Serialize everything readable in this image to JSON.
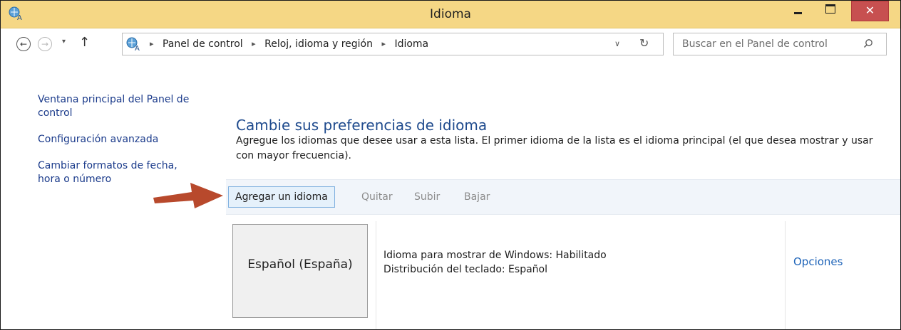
{
  "window": {
    "title": "Idioma",
    "close_glyph": "✕"
  },
  "nav": {
    "back_glyph": "←",
    "forward_glyph": "→",
    "recent_glyph": "▾",
    "up_glyph": "↑",
    "breadcrumbs": [
      "Panel de control",
      "Reloj, idioma y región",
      "Idioma"
    ],
    "separator": "▸",
    "dropdown_glyph": "∨",
    "refresh_glyph": "↻",
    "search_placeholder": "Buscar en el Panel de control"
  },
  "sidebar": {
    "links": [
      "Ventana principal del Panel de control",
      "Configuración avanzada",
      "Cambiar formatos de fecha, hora o número"
    ]
  },
  "main": {
    "heading": "Cambie sus preferencias de idioma",
    "description": "Agregue los idiomas que desee usar a esta lista. El primer idioma de la lista es el idioma principal (el que desea mostrar y usar con mayor frecuencia).",
    "toolbar": {
      "add": "Agregar un idioma",
      "remove": "Quitar",
      "up": "Subir",
      "down": "Bajar"
    },
    "languages": [
      {
        "name": "Español (España)",
        "display_status": "Idioma para mostrar de Windows: Habilitado",
        "keyboard": "Distribución del teclado: Español",
        "options": "Opciones"
      }
    ]
  },
  "colors": {
    "titlebar": "#f5d785",
    "close_button": "#c75050",
    "link": "#1b3b8b",
    "heading": "#1e4a8d",
    "arrow": "#b8492c"
  }
}
